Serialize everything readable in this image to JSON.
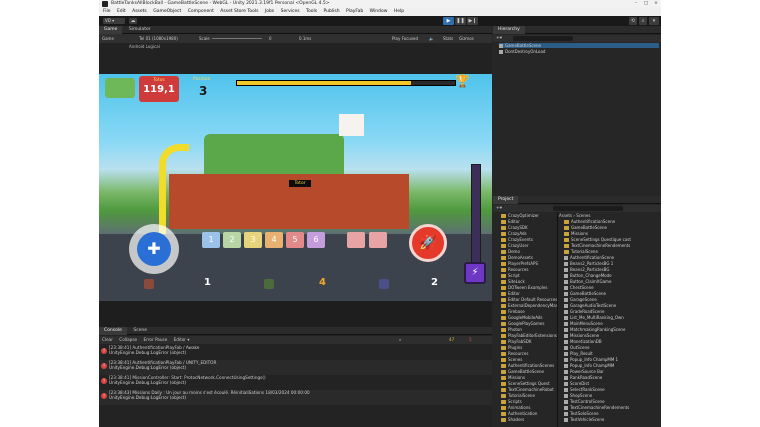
{
  "window": {
    "title": "BattleTanksAllBlockBall - GameBattleScene - WebGL - Unity 2021.3.19f1 Personal <OpenGL 4.5>"
  },
  "menu": [
    "File",
    "Edit",
    "Assets",
    "GameObject",
    "Component",
    "Asset Store Tools",
    "Jobs",
    "Services",
    "Tools",
    "Publish",
    "PlayFab",
    "Window",
    "Help"
  ],
  "toolbar": {
    "account_label": "VD ▾",
    "cloud_icon": "cloud-icon"
  },
  "game_panel": {
    "tabs": [
      "Game",
      "Simulator"
    ],
    "display": "Game",
    "resolution": "Tel 01 (1080x1980)",
    "scale_label": "Scale",
    "scale_value": "0",
    "fps_label": "0.1ms",
    "play_mode": "Play Focused",
    "stats_label": "Stats",
    "gizmos_label": "Gizmos",
    "platform_label": "Android Logical"
  },
  "game_hud": {
    "player_name": "Totos",
    "score": "119,1",
    "position_label": "Position",
    "position_value": "3",
    "tank_label": "Totor",
    "slots": [
      "1",
      "2",
      "3",
      "4",
      "5",
      "6"
    ],
    "bottom_scores": [
      "1",
      "4",
      "2"
    ]
  },
  "console_panel": {
    "tabs": [
      "Console",
      "Scene"
    ],
    "toolbar": [
      "Clear",
      "Collapse",
      "Error Pause",
      "Editor ▾"
    ],
    "counts": {
      "warnings": "47",
      "errors": "5"
    },
    "logs": [
      {
        "line1": "[23:38:41] AuthentificationPlayFab / Awake",
        "line2": "UnityEngine.Debug:LogError (object)"
      },
      {
        "line1": "[23:38:41] AuthentificationPlayFab / UNITY_EDITOR",
        "line2": "UnityEngine.Debug:LogError (object)"
      },
      {
        "line1": "[23:38:41] MissionController: Start: ProtocNetwork.ConnectUsingSettings()",
        "line2": "UnityEngine.Debug:LogError (object)"
      },
      {
        "line1": "[23:38:43] Missions Daily : Un jour au moins s'est écoulé. RéinitialiSations 18/03/2024 00:00:00",
        "line2": "UnityEngine.Debug:LogError (object)"
      }
    ]
  },
  "hierarchy": {
    "tab": "Hierarchy",
    "items": [
      "GameBattleScene",
      "DontDestroyOnLoad"
    ]
  },
  "project": {
    "tab": "Project",
    "breadcrumb": [
      "Assets",
      "Scenes"
    ],
    "tree": [
      "CrazyOptimizer",
      "Editor",
      "CrazySDK",
      "CrazyAds",
      "CrazyEvents",
      "CrazyUser",
      "Demo",
      "DemoAssets",
      "PlayerPrefsAPS",
      "Resources",
      "Script",
      "SiteLock",
      "DOTween Examples",
      "Editor",
      "Editor Default Resources",
      "ExternalDependencyManager",
      "Firebase",
      "GoogleMobileAds",
      "GooglePlayGames",
      "Photon",
      "PlayFabEditorExtensions",
      "PlayFabSDK",
      "Plugins",
      "Resources",
      "Scenes",
      "AuthentificationScenes",
      "GameBattleScene",
      "Missions",
      "SceneSettings Quest",
      "TextCinemachineRobot",
      "TutorialScene",
      "Scripts",
      "Animations",
      "Authentication",
      "Shaders"
    ],
    "files": [
      "AuthentificationScene",
      "GameBattleScene",
      "Missions",
      "SceneSettings Questique cast",
      "TextCinemachineRendements",
      "TutorialScene",
      "AuthentificationScene",
      "Beans2_ParticlesBG 1",
      "Beans2_ParticlesBG",
      "Button_ChangeMode",
      "Button_ClaimXGame",
      "ChestScene",
      "GameBattleScene",
      "GarageScene",
      "GarageAudioTestScene",
      "GradeRoadScene",
      "List_Me_MultiRanking_Own",
      "MainMenuScene",
      "MatchmakingRankingScene",
      "MissionsScene",
      "MonetizationDB",
      "OutScene",
      "Play_Result",
      "Popup_Info ChampMM 1",
      "Popup_Info ChampMM",
      "PowerSource Bar",
      "RankRoadScene",
      "ScoreDist",
      "SelectRankScene",
      "ShopScene",
      "TestControlScene",
      "TextCinemachineRendements",
      "TestSoloScene",
      "TestVehicleScene"
    ]
  },
  "colors": {
    "editor_bg": "#1f1f1f",
    "accent_blue": "#2c5d87",
    "error_red": "#d64545",
    "folder_yellow": "#c9a43a"
  }
}
